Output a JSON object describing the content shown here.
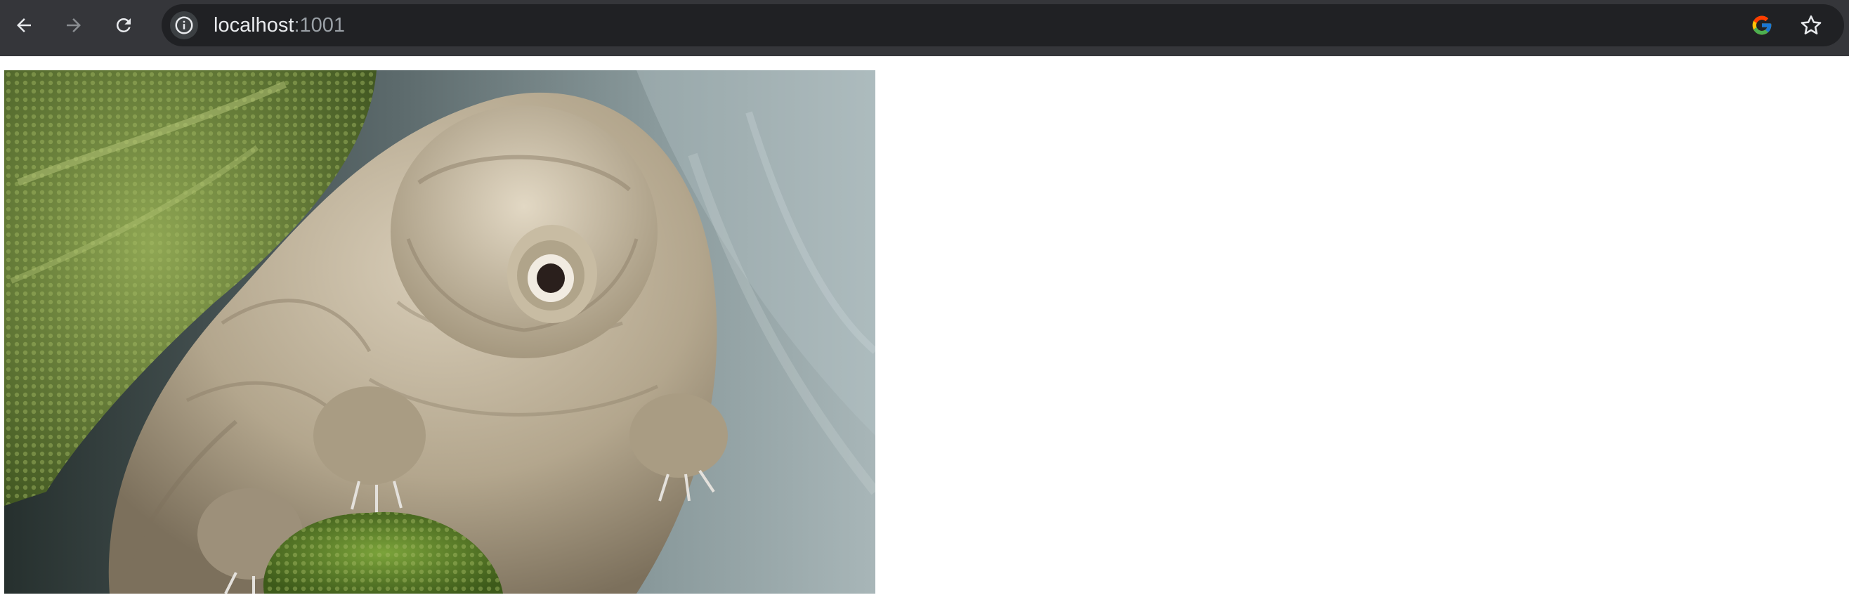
{
  "browser": {
    "url_host": "localhost",
    "url_port": ":1001",
    "icons": {
      "back": "back-arrow-icon",
      "forward": "forward-arrow-icon",
      "reload": "reload-icon",
      "site_info": "info-icon",
      "search_engine": "google-icon",
      "bookmark": "star-icon"
    }
  },
  "page": {
    "image": {
      "subject": "tardigrade"
    }
  },
  "colors": {
    "toolbar_bg": "#35363a",
    "omnibox_bg": "#202124",
    "page_bg": "#ffffff"
  }
}
